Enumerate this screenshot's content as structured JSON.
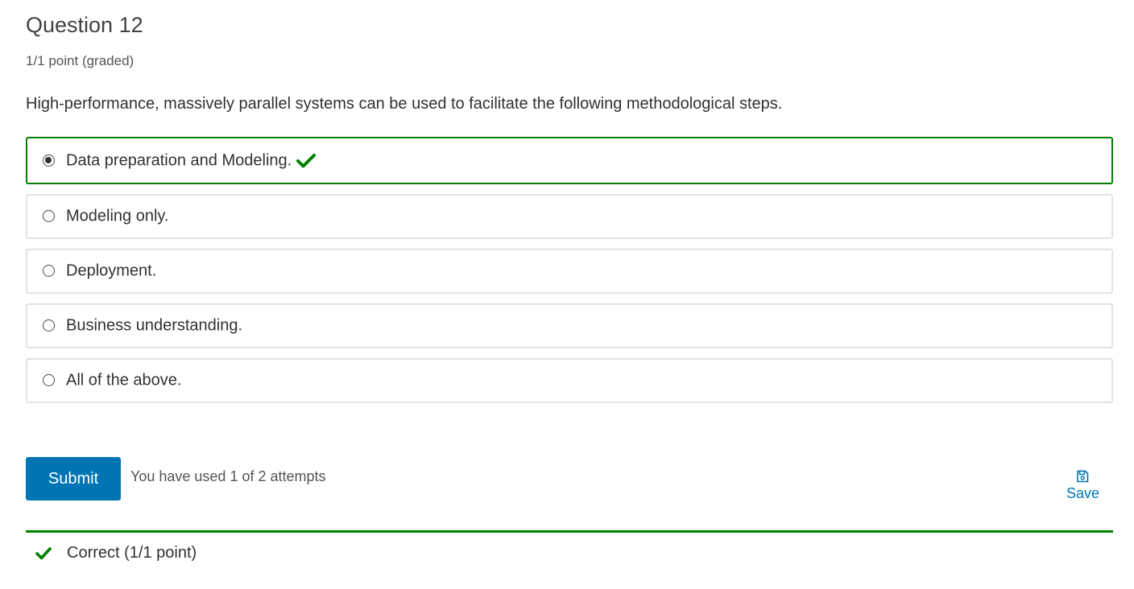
{
  "question": {
    "title": "Question 12",
    "points": "1/1 point (graded)",
    "prompt": "High-performance, massively parallel systems can be used to facilitate the following methodological steps."
  },
  "options": [
    {
      "label": "Data preparation and Modeling.",
      "selected": true,
      "correct": true
    },
    {
      "label": "Modeling only.",
      "selected": false
    },
    {
      "label": "Deployment.",
      "selected": false
    },
    {
      "label": "Business understanding.",
      "selected": false
    },
    {
      "label": "All of the above.",
      "selected": false
    }
  ],
  "actions": {
    "submit_label": "Submit",
    "attempts_text": "You have used 1 of 2 attempts",
    "save_label": "Save"
  },
  "result": {
    "text": "Correct (1/1 point)"
  },
  "icons": {
    "check": "check-icon",
    "save": "floppy-disk-icon"
  },
  "colors": {
    "accent": "#0075b4",
    "success": "#008100",
    "border": "#e2e2e2"
  }
}
